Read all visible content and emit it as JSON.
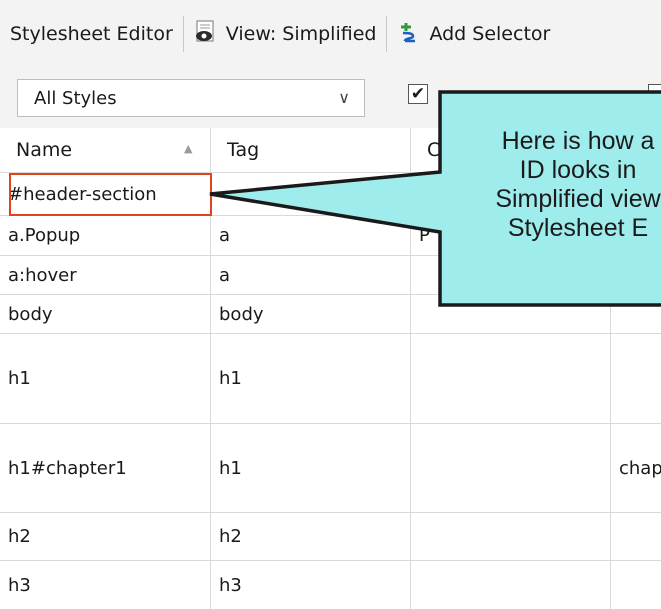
{
  "toolbar": {
    "editor_label": "Stylesheet Editor",
    "view_label": "View: Simplified",
    "add_selector_label": "Add Selector"
  },
  "filter": {
    "styles_select_value": "All Styles",
    "checkbox_checked": true
  },
  "table": {
    "headers": [
      "Name",
      "Tag",
      "C",
      ""
    ],
    "rows": [
      {
        "name": "#header-section",
        "tag": "",
        "c3": "",
        "c4": ""
      },
      {
        "name": "a.Popup",
        "tag": "a",
        "c3": "P",
        "c4": ""
      },
      {
        "name": "a:hover",
        "tag": "a",
        "c3": "",
        "c4": ""
      },
      {
        "name": "body",
        "tag": "body",
        "c3": "",
        "c4": ""
      },
      {
        "name": "h1",
        "tag": "h1",
        "c3": "",
        "c4": ""
      },
      {
        "name": "h1#chapter1",
        "tag": "h1",
        "c3": "",
        "c4": "chap"
      },
      {
        "name": "h2",
        "tag": "h2",
        "c3": "",
        "c4": ""
      },
      {
        "name": "h3",
        "tag": "h3",
        "c3": "",
        "c4": ""
      }
    ]
  },
  "callout": {
    "lines": [
      "Here is how a",
      "ID looks in",
      "Simplified view",
      "Stylesheet E"
    ]
  },
  "colors": {
    "callout_fill": "#9fecec",
    "highlight_border": "#e1441c",
    "grid_line": "#d9d9d9"
  },
  "icons": [
    "view-eye-icon",
    "add-selector-icon",
    "chevron-down-icon",
    "sort-up-icon",
    "check-icon"
  ]
}
